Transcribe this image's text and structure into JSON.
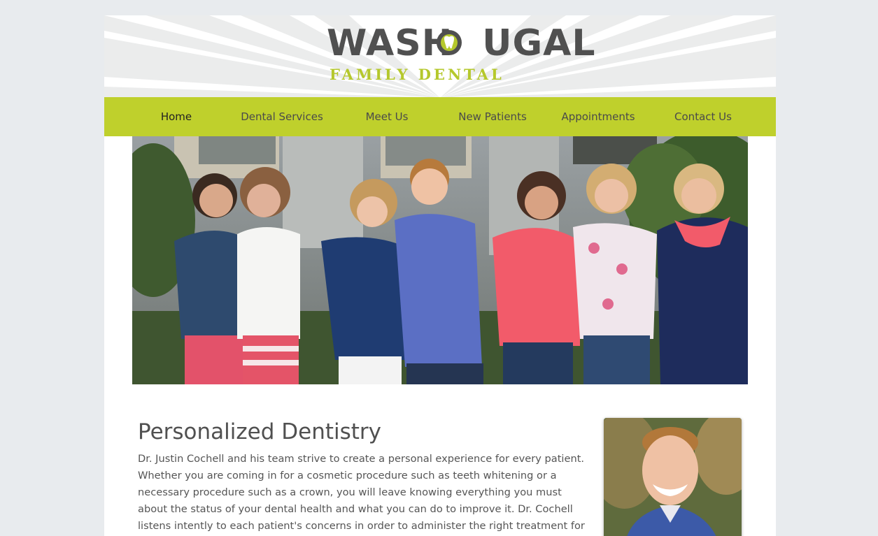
{
  "logo": {
    "name_part1": "WASH",
    "name_part2": "UGAL",
    "tagline": "FAMILY DENTAL",
    "colors": {
      "dark": "#505050",
      "green": "#b5c82c"
    }
  },
  "nav": {
    "items": [
      {
        "label": "Home",
        "active": true
      },
      {
        "label": "Dental Services"
      },
      {
        "label": "Meet Us"
      },
      {
        "label": "New Patients"
      },
      {
        "label": "Appointments"
      },
      {
        "label": "Contact Us"
      }
    ],
    "color": "#bfd02c"
  },
  "hero": {
    "image": "team-photo"
  },
  "content": {
    "title": "Personalized Dentistry",
    "body": "Dr. Justin Cochell and his team strive to create a personal experience for every patient. Whether you are coming in for a cosmetic procedure such as teeth whitening or a necessary procedure such as a crown, you will leave knowing everything you must about the status of your dental health and what you can do to improve it. Dr. Cochell listens intently to each patient's concerns in order to administer the right treatment for them. As a"
  },
  "doctor_photo": {
    "image": "doctor-portrait"
  }
}
